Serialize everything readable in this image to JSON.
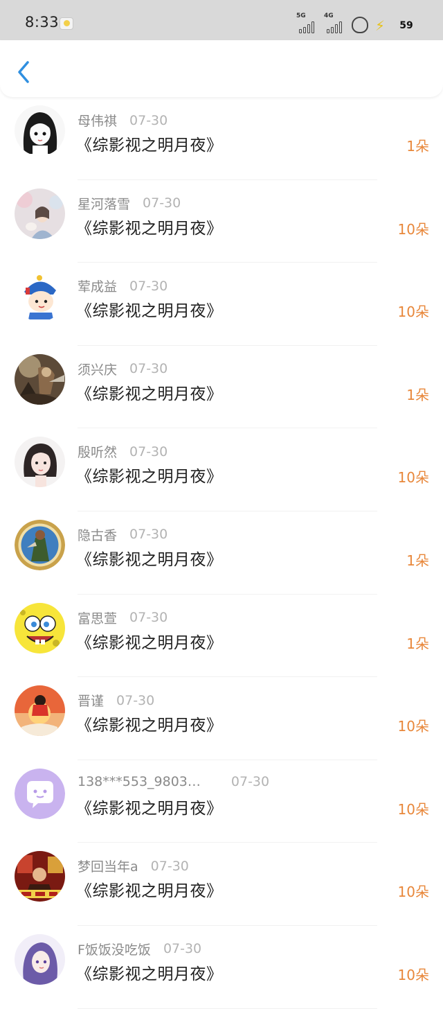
{
  "status_bar": {
    "time": "8:33",
    "signal_1_label": "5G",
    "signal_2_label": "4G",
    "battery": "59"
  },
  "nav": {
    "back_icon": "chevron-left-icon"
  },
  "colors": {
    "accent_gift": "#e8873a",
    "back_icon": "#2f8fe0"
  },
  "rows": [
    {
      "username": "母伟祺",
      "date": "07-30",
      "title": "《综影视之明月夜》",
      "gift": "1朵",
      "avatar": "anime-girl-bw"
    },
    {
      "username": "星河落雪",
      "date": "07-30",
      "title": "《综影视之明月夜》",
      "gift": "10朵",
      "avatar": "girl-pink-photo"
    },
    {
      "username": "荤成益",
      "date": "07-30",
      "title": "《综影视之明月夜》",
      "gift": "10朵",
      "avatar": "cartoon-prince"
    },
    {
      "username": "须兴庆",
      "date": "07-30",
      "title": "《综影视之明月夜》",
      "gift": "1朵",
      "avatar": "fantasy-warrior"
    },
    {
      "username": "殷听然",
      "date": "07-30",
      "title": "《综影视之明月夜》",
      "gift": "10朵",
      "avatar": "girl-portrait"
    },
    {
      "username": "隐古香",
      "date": "07-30",
      "title": "《综影视之明月夜》",
      "gift": "1朵",
      "avatar": "medal-figure"
    },
    {
      "username": "富思萱",
      "date": "07-30",
      "title": "《综影视之明月夜》",
      "gift": "1朵",
      "avatar": "spongebob-face"
    },
    {
      "username": "晋谨",
      "date": "07-30",
      "title": "《综影视之明月夜》",
      "gift": "10朵",
      "avatar": "red-kid-sunset"
    },
    {
      "username": "138***553_9803…",
      "date": "07-30",
      "title": "《综影视之明月夜》",
      "gift": "10朵",
      "avatar": "default-chat-bubble"
    },
    {
      "username": "梦回当年a",
      "date": "07-30",
      "title": "《综影视之明月夜》",
      "gift": "10朵",
      "avatar": "movie-poster"
    },
    {
      "username": "F饭饭没吃饭",
      "date": "07-30",
      "title": "《综影视之明月夜》",
      "gift": "10朵",
      "avatar": "anime-girl-purple"
    }
  ]
}
